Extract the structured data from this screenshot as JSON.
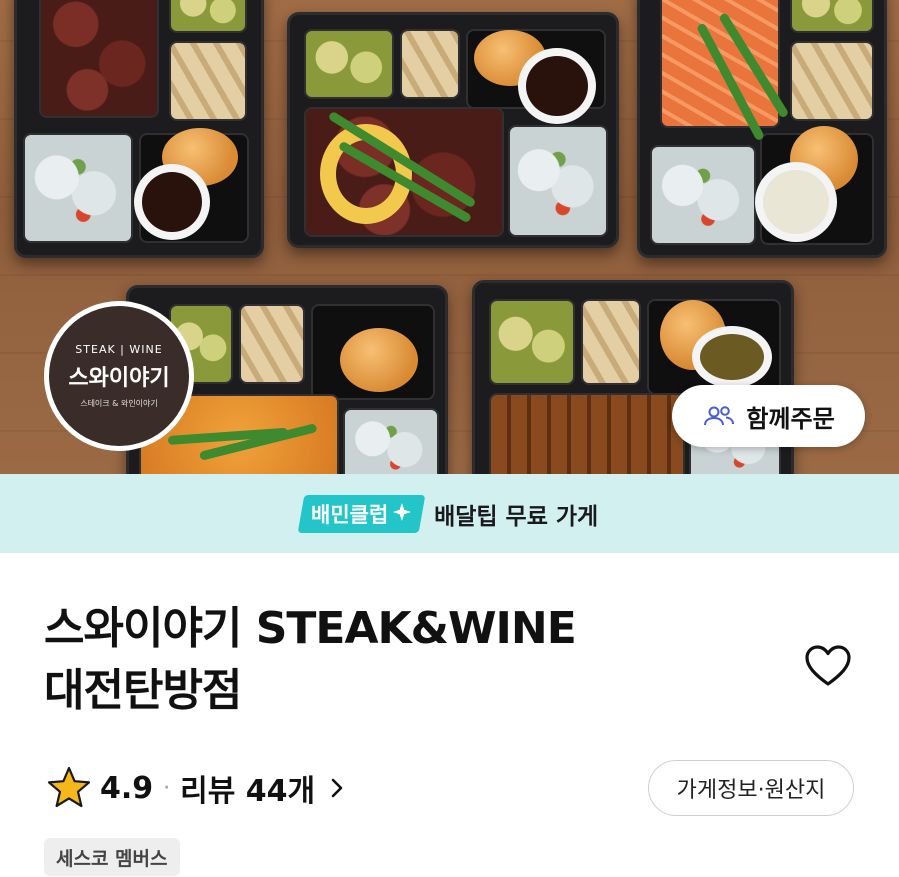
{
  "hero": {
    "logo": {
      "top_text": "STEAK | WINE",
      "main_text": "스와이야기",
      "sub_text": "스테이크 & 와인이야기"
    },
    "group_order_label": "함께주문",
    "group_order_icon": "people-icon"
  },
  "club_banner": {
    "badge_label": "배민클럽",
    "badge_icon": "sparkle-icon",
    "text": "배달팁 무료 가게",
    "bg_color": "#d3f0f1",
    "badge_color": "#23c5c9"
  },
  "store": {
    "name_line1": "스와이야기 STEAK&WINE",
    "name_line2": "대전탄방점",
    "rating": "4.9",
    "separator": "·",
    "reviews_label": "리뷰 44개",
    "info_button_label": "가게정보·원산지",
    "tag": "세스코 멤버스",
    "star_color": "#f5b71a"
  }
}
